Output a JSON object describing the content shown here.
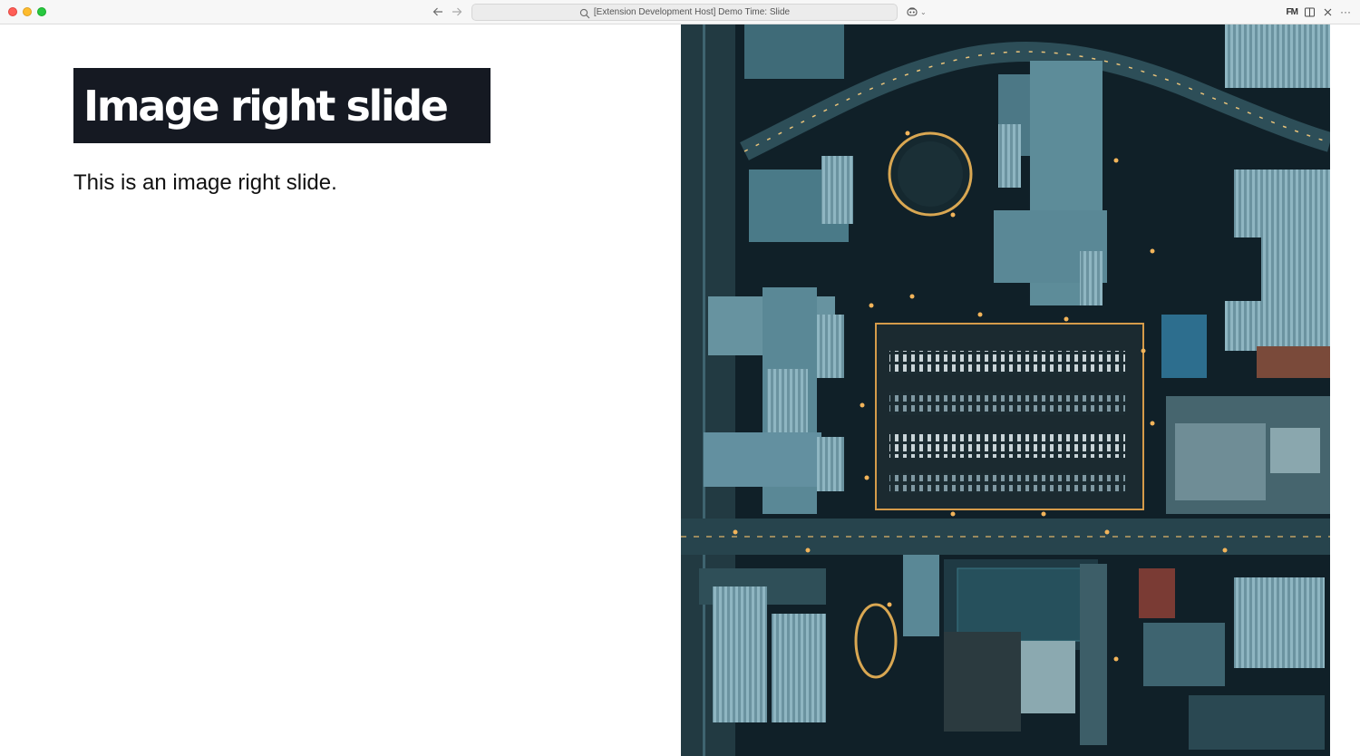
{
  "window": {
    "command_center_text": "[Extension Development Host] Demo Time: Slide",
    "extension_badge": "FM",
    "more_label": "···"
  },
  "slide": {
    "heading": "Image right slide",
    "body": "This is an image right slide.",
    "heading_bg": "#151922",
    "image": {
      "description_icon": "aerial-city-photo",
      "tones": [
        "#0e1a20",
        "#1f4b58",
        "#5f9aa6",
        "#f2b45a"
      ]
    }
  },
  "colors": {
    "close": "#ff5f57",
    "minimize": "#febc2e",
    "maximize": "#28c840"
  }
}
